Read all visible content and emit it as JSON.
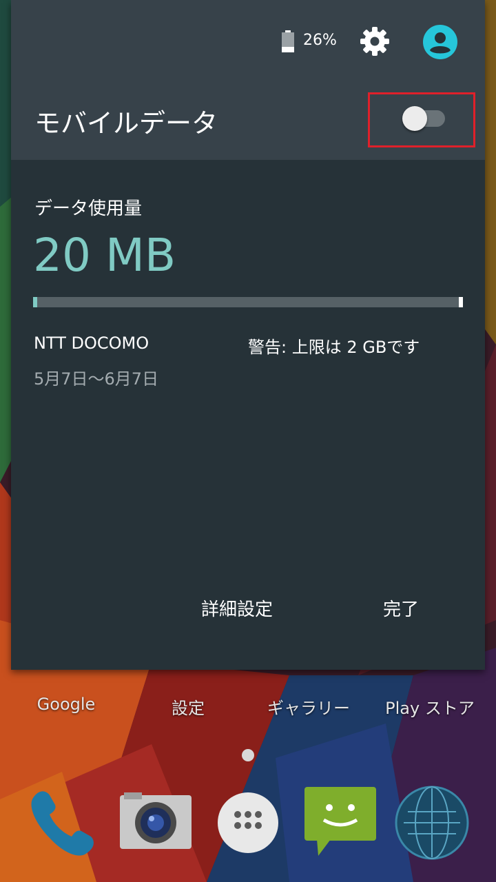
{
  "status": {
    "battery_icon": "battery-icon",
    "battery_percent": "26%",
    "settings_icon": "gear-icon",
    "user_icon": "account-circle-icon"
  },
  "mobile_data": {
    "title": "モバイルデータ",
    "switch_state": "off"
  },
  "usage": {
    "label": "データ使用量",
    "amount": "20 MB",
    "progress_fraction": 0.01,
    "carrier": "NTT DOCOMO",
    "warning": "警告: 上限は 2 GBです",
    "period": "5月7日〜6月7日"
  },
  "actions": {
    "more_settings": "詳細設定",
    "done": "完了"
  },
  "home_apps": [
    {
      "label": "Google"
    },
    {
      "label": "設定"
    },
    {
      "label": "ギャラリー"
    },
    {
      "label": "Play ストア"
    }
  ],
  "dock": [
    {
      "icon": "phone-icon"
    },
    {
      "icon": "camera-icon"
    },
    {
      "icon": "app-drawer-icon"
    },
    {
      "icon": "messaging-icon"
    },
    {
      "icon": "browser-globe-icon"
    }
  ],
  "colors": {
    "accent": "#80cbc4",
    "panel": "#263238",
    "header": "#37424a",
    "highlight": "#e0202a"
  }
}
